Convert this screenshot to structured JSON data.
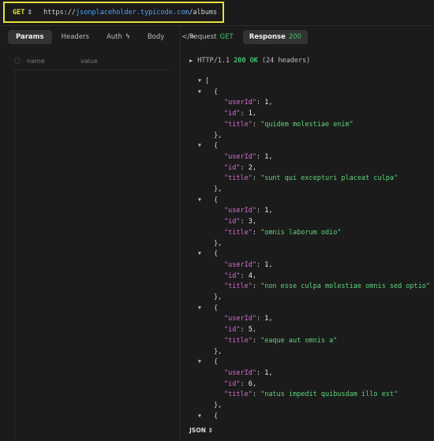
{
  "request": {
    "method": "GET",
    "url_scheme": "https://",
    "url_host": "jsonplaceholder.typicode.com",
    "url_path": "/albums"
  },
  "left_tabs": [
    {
      "label": "Params",
      "active": true
    },
    {
      "label": "Headers",
      "active": false
    },
    {
      "label": "Auth",
      "active": false
    },
    {
      "label": "Body",
      "active": false
    },
    {
      "label": "</>",
      "active": false
    }
  ],
  "params_table": {
    "col_name": "name",
    "col_value": "value"
  },
  "right_tabs": {
    "request_label": "Request",
    "request_method": "GET",
    "response_label": "Response",
    "response_code": "200"
  },
  "status": {
    "version": "HTTP/1.1",
    "code_text": "200 OK",
    "headers": "(24 headers)"
  },
  "albums": [
    {
      "userId": "1",
      "id": "1",
      "title": "\"quidem molestiae enim\""
    },
    {
      "userId": "1",
      "id": "2",
      "title": "\"sunt qui excepturi placeat culpa\""
    },
    {
      "userId": "1",
      "id": "3",
      "title": "\"omnis laborum odio\""
    },
    {
      "userId": "1",
      "id": "4",
      "title": "\"non esse culpa molestiae omnis sed optio\""
    },
    {
      "userId": "1",
      "id": "5",
      "title": "\"eaque aut omnis a\""
    },
    {
      "userId": "1",
      "id": "6",
      "title": "\"natus impedit quibusdam illo est\""
    }
  ],
  "json_keys": {
    "userId": "\"userId\"",
    "id": "\"id\"",
    "title": "\"title\""
  },
  "footer": {
    "format": "JSON",
    "caret": "⇕"
  },
  "colors": {
    "method": "#e6e03a",
    "ok": "#3fc06d",
    "key": "#d96bd0",
    "string": "#5fd47b",
    "url_host": "#4fa3ff"
  }
}
